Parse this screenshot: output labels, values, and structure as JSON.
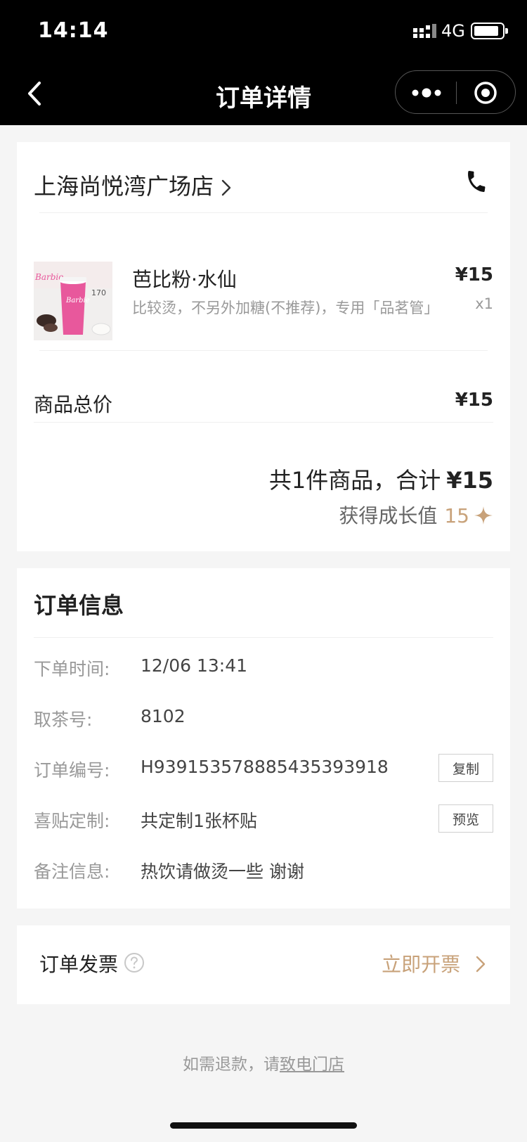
{
  "status_bar": {
    "time": "14:14",
    "network": "4G",
    "battery_level": 0.9,
    "colors": {
      "background": "#000000",
      "text": "#ffffff"
    }
  },
  "nav": {
    "title": "订单详情",
    "back_icon": "chevron-left-icon",
    "menu_icon": "more-dots-icon",
    "close_icon": "target-circle-icon"
  },
  "order": {
    "store_name": "上海尚悦湾广场店",
    "phone_icon": "phone-icon",
    "product": {
      "image_text": "Barbie",
      "image_cup_text": "170",
      "name": "芭比粉·水仙",
      "description": "比较烫，不另外加糖(不推荐)，专用「品茗管」",
      "price": "¥15",
      "quantity": "x1"
    },
    "subtotal_label": "商品总价",
    "subtotal_value": "¥15",
    "summary_prefix": "共1件商品，合计",
    "summary_total": "¥15",
    "growth_label": "获得成长值",
    "growth_value": "15"
  },
  "order_info": {
    "title": "订单信息",
    "rows": [
      {
        "label": "下单时间:",
        "value": "12/06 13:41"
      },
      {
        "label": "取茶号:",
        "value": "8102"
      },
      {
        "label": "订单编号:",
        "value": "H939153578885435393918",
        "button": "复制"
      },
      {
        "label": "喜贴定制:",
        "value": "共定制1张杯贴",
        "button": "预览"
      },
      {
        "label": "备注信息:",
        "value": "热饮请做烫一些 谢谢"
      }
    ]
  },
  "invoice": {
    "label": "订单发票",
    "action": "立即开票"
  },
  "refund": {
    "prefix": "如需退款，请",
    "link": "致电门店"
  },
  "colors": {
    "accent": "#c8a27a",
    "page_bg": "#f5f5f5",
    "barbie_pink": "#e8589c"
  }
}
